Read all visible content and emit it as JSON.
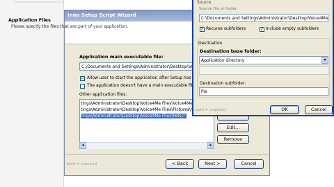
{
  "wizard": {
    "title": "Inno Setup Script Wizard",
    "header_title": "Application Files",
    "header_desc": "Please specify the files that are part of your application.",
    "exe_label": "Application main executable file:",
    "exe_value": "C:\\Documents and Settings\\Administrator\\Desktop\\Voi",
    "allow_start_label": "Allow user to start the application after Setup has finis",
    "no_exe_label": "The application doesn't have a main executable file",
    "files_label": "Other application files:",
    "files": [
      "tings\\Administrator\\Desktop\\Voice4Me Files\\Voice4Me",
      "tings\\Administrator\\Desktop\\Voice4Me Files\\Pictures\\*",
      "tings\\Administrator\\Desktop\\Voice4Me Files\\Pets\\*"
    ],
    "edit_label": "Edit...",
    "remove_label": "Remove",
    "bold_note": "bold = required",
    "back_label": "< Back",
    "next_label": "Next >",
    "cancel_label": "Cancel"
  },
  "dialog": {
    "source_label": "Source",
    "source_sub": "Source file or folder:",
    "source_value": "C:\\Documents and Settings\\Administrator\\Desktop\\Voice4Me F",
    "recurse_label": "Recurse subfolders",
    "include_empty_label": "Include empty subfolders",
    "destination_label": "Destination",
    "dest_base_label": "Destination base folder:",
    "dest_base_value": "Application directory",
    "subfolder_label": "Destination subfolder:",
    "subfolder_value": "Pie",
    "bold_note": "bold = required",
    "ok_label": "OK",
    "cancel_label": "Cancel"
  },
  "colors": {
    "titlebar": "#7f98c6",
    "selection": "#316ac5",
    "dialog_border": "#0b3ea6"
  }
}
